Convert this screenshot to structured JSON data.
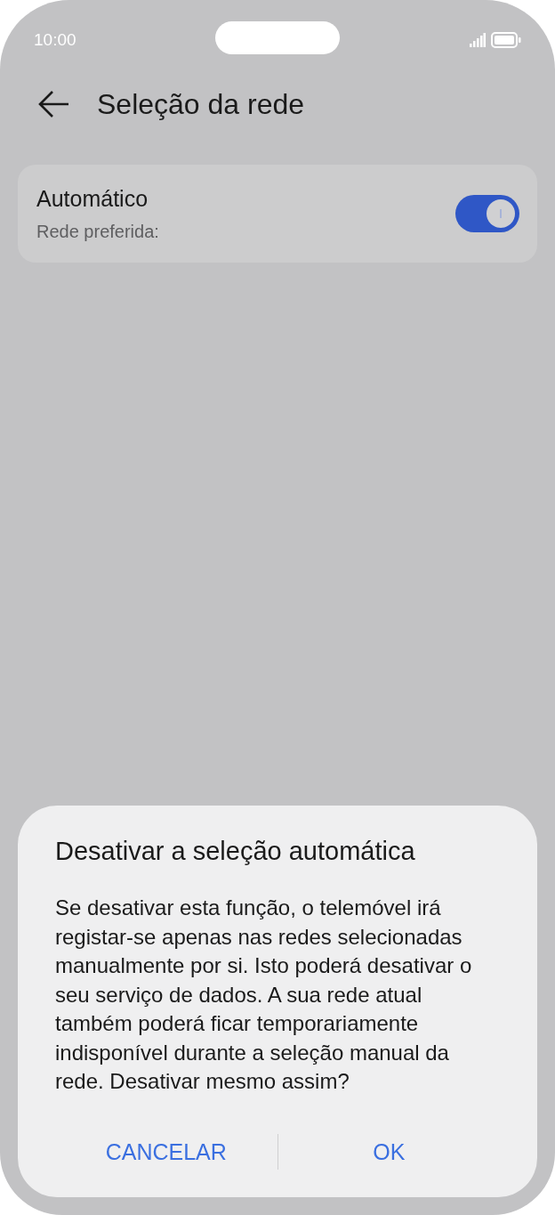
{
  "status_bar": {
    "time": "10:00"
  },
  "header": {
    "title": "Seleção da rede"
  },
  "setting": {
    "title": "Automático",
    "subtitle": "Rede preferida:",
    "on": true
  },
  "dialog": {
    "title": "Desativar a seleção automática",
    "message": "Se desativar esta função, o telemóvel irá registar-se apenas nas redes selecionadas manualmente por si. Isto poderá desativar o seu serviço de dados. A sua rede atual também poderá ficar temporariamente indisponível durante a seleção manual da rede. Desativar mesmo assim?",
    "buttons": [
      "CANCELAR",
      "OK"
    ]
  }
}
